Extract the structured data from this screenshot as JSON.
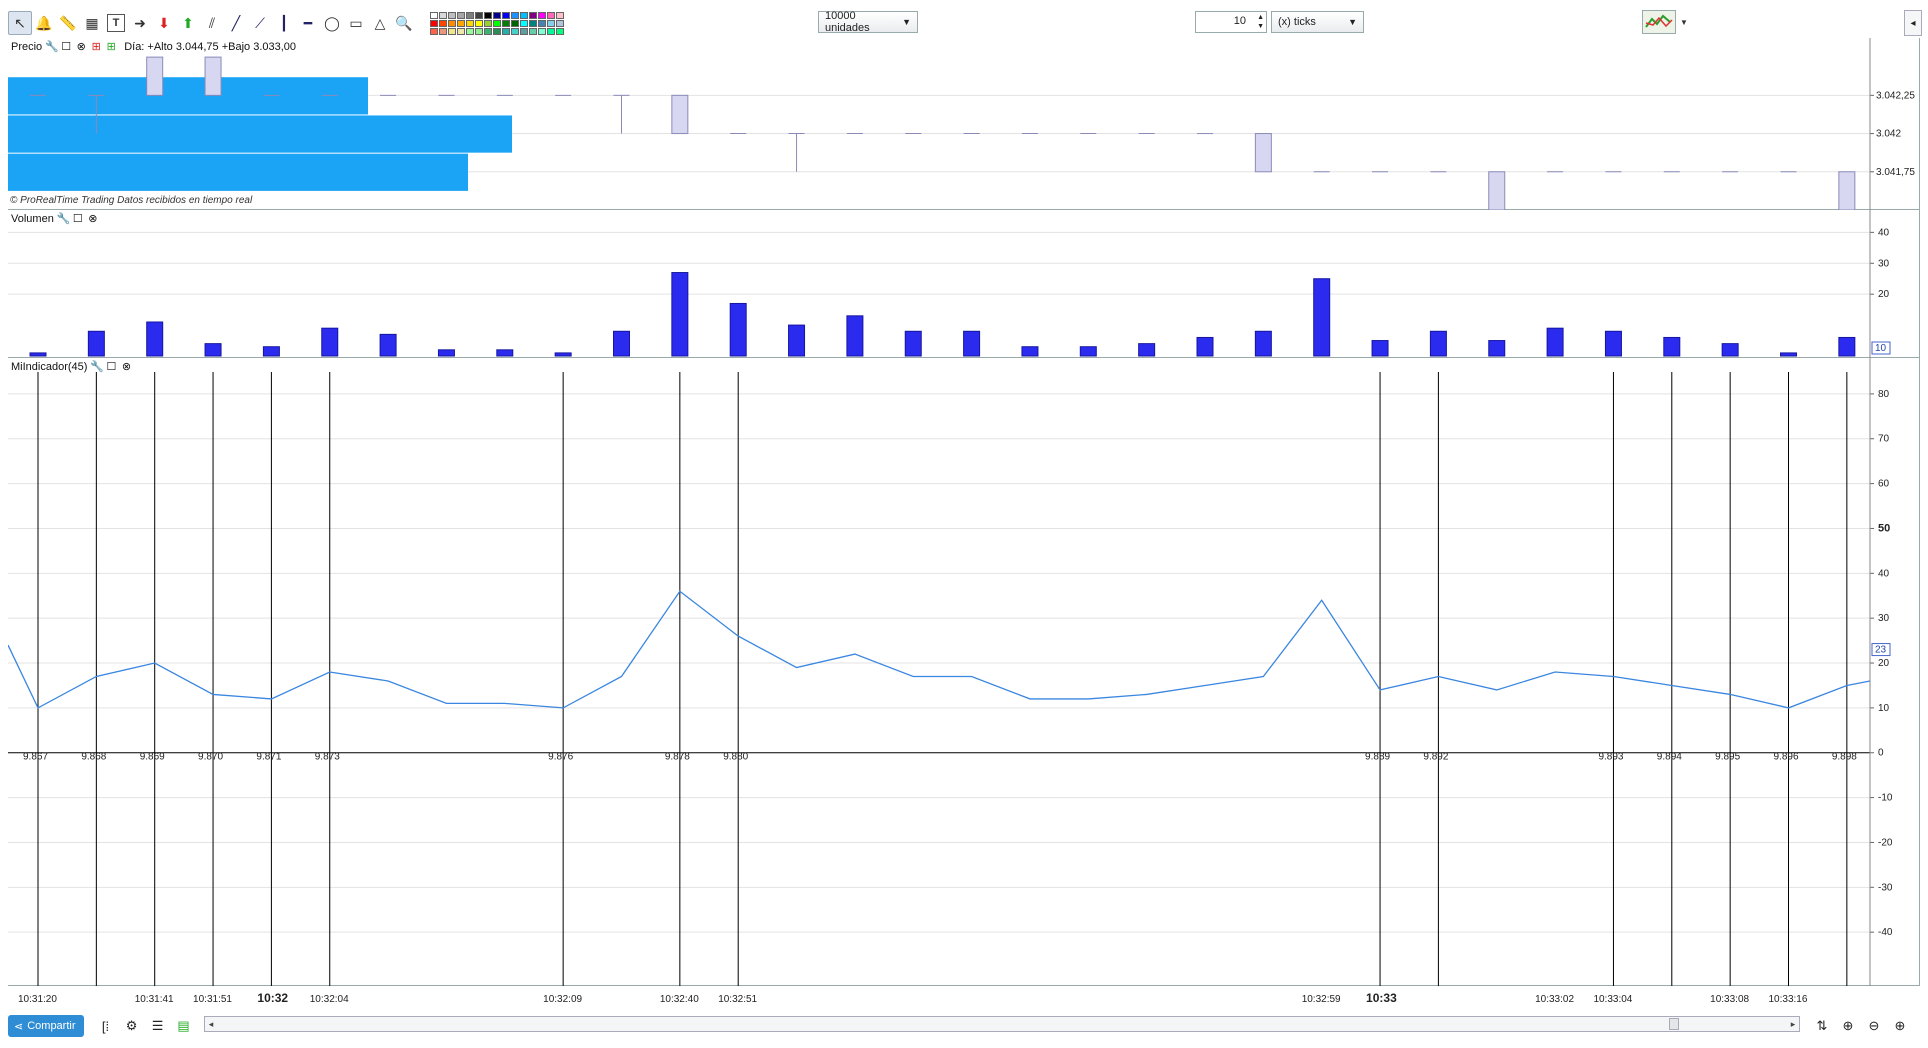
{
  "toolbar": {
    "units_value": "10000 unidades",
    "ticks_count": "10",
    "ticks_unit": "(x) ticks",
    "palette_colors": [
      "#ffffff",
      "#d9d9d9",
      "#bfbfbf",
      "#a6a6a6",
      "#7f7f7f",
      "#404040",
      "#000000",
      "#00008b",
      "#0000ff",
      "#1e90ff",
      "#00bfff",
      "#800080",
      "#ff00ff",
      "#ff69b4",
      "#ffc0cb",
      "#ff0000",
      "#ff4500",
      "#ff8c00",
      "#ffa500",
      "#ffd700",
      "#ffff00",
      "#9acd32",
      "#00ff00",
      "#008000",
      "#006400",
      "#00ffff",
      "#008080",
      "#4682b4",
      "#87ceeb",
      "#b0c4de",
      "#ff6347",
      "#e9967a",
      "#f0e68c",
      "#eee8aa",
      "#98fb98",
      "#90ee90",
      "#3cb371",
      "#2e8b57",
      "#20b2aa",
      "#48d1cc",
      "#5f9ea0",
      "#66cdaa",
      "#7fffd4",
      "#00fa9a",
      "#00ff7f"
    ]
  },
  "price_pane": {
    "label": "Precio",
    "info": "Día: +Alto 3.044,75 +Bajo 3.033,00",
    "watermark": "© ProRealTime Trading  Datos recibidos en tiempo real",
    "axis_labels": [
      "3.042,25",
      "3.042",
      "3.041,75"
    ],
    "axis_values": [
      3042.25,
      3042.0,
      3041.75
    ],
    "profile_bars": [
      {
        "price": 3042.25,
        "volume": 360
      },
      {
        "price": 3042.0,
        "volume": 504
      },
      {
        "price": 3041.75,
        "volume": 460
      }
    ],
    "bars": [
      {
        "o": 3042.25,
        "c": 3042.25,
        "h": 3042.25,
        "l": 3042.25
      },
      {
        "o": 3042.25,
        "c": 3042.25,
        "h": 3042.25,
        "l": 3042.0
      },
      {
        "o": 3042.25,
        "c": 3042.5,
        "h": 3042.5,
        "l": 3042.25
      },
      {
        "o": 3042.25,
        "c": 3042.5,
        "h": 3042.5,
        "l": 3042.25
      },
      {
        "o": 3042.25,
        "c": 3042.25,
        "h": 3042.25,
        "l": 3042.25
      },
      {
        "o": 3042.25,
        "c": 3042.25,
        "h": 3042.25,
        "l": 3042.25
      },
      {
        "o": 3042.25,
        "c": 3042.25,
        "h": 3042.25,
        "l": 3042.25
      },
      {
        "o": 3042.25,
        "c": 3042.25,
        "h": 3042.25,
        "l": 3042.25
      },
      {
        "o": 3042.25,
        "c": 3042.25,
        "h": 3042.25,
        "l": 3042.25
      },
      {
        "o": 3042.25,
        "c": 3042.25,
        "h": 3042.25,
        "l": 3042.25
      },
      {
        "o": 3042.25,
        "c": 3042.25,
        "h": 3042.25,
        "l": 3042.0
      },
      {
        "o": 3042.0,
        "c": 3042.25,
        "h": 3042.25,
        "l": 3042.0
      },
      {
        "o": 3042.0,
        "c": 3042.0,
        "h": 3042.0,
        "l": 3042.0
      },
      {
        "o": 3042.0,
        "c": 3042.0,
        "h": 3042.0,
        "l": 3041.75
      },
      {
        "o": 3042.0,
        "c": 3042.0,
        "h": 3042.0,
        "l": 3042.0
      },
      {
        "o": 3042.0,
        "c": 3042.0,
        "h": 3042.0,
        "l": 3042.0
      },
      {
        "o": 3042.0,
        "c": 3042.0,
        "h": 3042.0,
        "l": 3042.0
      },
      {
        "o": 3042.0,
        "c": 3042.0,
        "h": 3042.0,
        "l": 3042.0
      },
      {
        "o": 3042.0,
        "c": 3042.0,
        "h": 3042.0,
        "l": 3042.0
      },
      {
        "o": 3042.0,
        "c": 3042.0,
        "h": 3042.0,
        "l": 3042.0
      },
      {
        "o": 3042.0,
        "c": 3042.0,
        "h": 3042.0,
        "l": 3042.0
      },
      {
        "o": 3041.75,
        "c": 3042.0,
        "h": 3042.0,
        "l": 3041.75
      },
      {
        "o": 3041.75,
        "c": 3041.75,
        "h": 3041.75,
        "l": 3041.75
      },
      {
        "o": 3041.75,
        "c": 3041.75,
        "h": 3041.75,
        "l": 3041.75
      },
      {
        "o": 3041.75,
        "c": 3041.75,
        "h": 3041.75,
        "l": 3041.75
      },
      {
        "o": 3041.5,
        "c": 3041.75,
        "h": 3041.75,
        "l": 3041.5
      },
      {
        "o": 3041.75,
        "c": 3041.75,
        "h": 3041.75,
        "l": 3041.75
      },
      {
        "o": 3041.75,
        "c": 3041.75,
        "h": 3041.75,
        "l": 3041.75
      },
      {
        "o": 3041.75,
        "c": 3041.75,
        "h": 3041.75,
        "l": 3041.75
      },
      {
        "o": 3041.75,
        "c": 3041.75,
        "h": 3041.75,
        "l": 3041.75
      },
      {
        "o": 3041.75,
        "c": 3041.75,
        "h": 3041.75,
        "l": 3041.75
      },
      {
        "o": 3041.5,
        "c": 3041.75,
        "h": 3041.75,
        "l": 3041.5
      }
    ]
  },
  "volume_pane": {
    "label": "Volumen",
    "axis_labels": [
      "40",
      "30",
      "20"
    ],
    "axis_values": [
      40,
      30,
      20
    ],
    "current_label": "10",
    "values": [
      1,
      8,
      11,
      4,
      3,
      9,
      7,
      2,
      2,
      1,
      8,
      27,
      17,
      10,
      13,
      8,
      8,
      3,
      3,
      4,
      6,
      8,
      25,
      5,
      8,
      5,
      9,
      8,
      6,
      4,
      1,
      6
    ]
  },
  "indicator_pane": {
    "label": "MiIndicador(45)",
    "axis_labels": [
      "80",
      "70",
      "60",
      "50",
      "40",
      "30",
      "20",
      "10",
      "0",
      "-10",
      "-20",
      "-30",
      "-40"
    ],
    "axis_values": [
      80,
      70,
      60,
      50,
      40,
      30,
      20,
      10,
      0,
      -10,
      -20,
      -30,
      -40
    ],
    "current_label": "23",
    "line_values": [
      24,
      10,
      17,
      20,
      13,
      12,
      18,
      16,
      11,
      11,
      10,
      17,
      36,
      26,
      19,
      22,
      17,
      17,
      12,
      12,
      13,
      15,
      17,
      34,
      14,
      17,
      14,
      18,
      17,
      15,
      13,
      10,
      15,
      16
    ],
    "line_color": "#3a86e0",
    "vertical_line_bars": [
      0,
      1,
      2,
      3,
      4,
      5,
      9,
      11,
      12,
      23,
      24,
      27,
      28,
      29,
      30,
      31
    ],
    "bar_numbers": [
      {
        "bar": 0,
        "label": "9.867"
      },
      {
        "bar": 1,
        "label": "9.868"
      },
      {
        "bar": 2,
        "label": "9.869"
      },
      {
        "bar": 3,
        "label": "9.870"
      },
      {
        "bar": 4,
        "label": "9.871"
      },
      {
        "bar": 5,
        "label": "9.873"
      },
      {
        "bar": 9,
        "label": "9.876"
      },
      {
        "bar": 11,
        "label": "9.878"
      },
      {
        "bar": 12,
        "label": "9.880"
      },
      {
        "bar": 23,
        "label": "9.889"
      },
      {
        "bar": 24,
        "label": "9.892"
      },
      {
        "bar": 27,
        "label": "9.893"
      },
      {
        "bar": 28,
        "label": "9.894"
      },
      {
        "bar": 29,
        "label": "9.895"
      },
      {
        "bar": 30,
        "label": "9.896"
      },
      {
        "bar": 31,
        "label": "9.898"
      }
    ]
  },
  "time_axis": [
    {
      "bar": 0,
      "label": "10:31:20",
      "bold": false
    },
    {
      "bar": 2,
      "label": "10:31:41",
      "bold": false
    },
    {
      "bar": 3,
      "label": "10:31:51",
      "bold": false
    },
    {
      "bar": 4,
      "label": "10:32",
      "bold": true
    },
    {
      "bar": 5,
      "label": "10:32:04",
      "bold": false
    },
    {
      "bar": 9,
      "label": "10:32:09",
      "bold": false
    },
    {
      "bar": 11,
      "label": "10:32:40",
      "bold": false
    },
    {
      "bar": 12,
      "label": "10:32:51",
      "bold": false
    },
    {
      "bar": 22,
      "label": "10:32:59",
      "bold": false
    },
    {
      "bar": 23,
      "label": "10:33",
      "bold": true
    },
    {
      "bar": 26,
      "label": "10:33:02",
      "bold": false
    },
    {
      "bar": 27,
      "label": "10:33:04",
      "bold": false
    },
    {
      "bar": 29,
      "label": "10:33:08",
      "bold": false
    },
    {
      "bar": 30,
      "label": "10:33:16",
      "bold": false
    }
  ],
  "footer": {
    "share_label": "Compartir"
  },
  "colors": {
    "profile_bar": "#1ba3f5",
    "candle_fill": "#d7d7f2",
    "candle_stroke": "#8a8ab8",
    "volume_bar": "#2b2bef",
    "grid": "#e3e3e3"
  }
}
